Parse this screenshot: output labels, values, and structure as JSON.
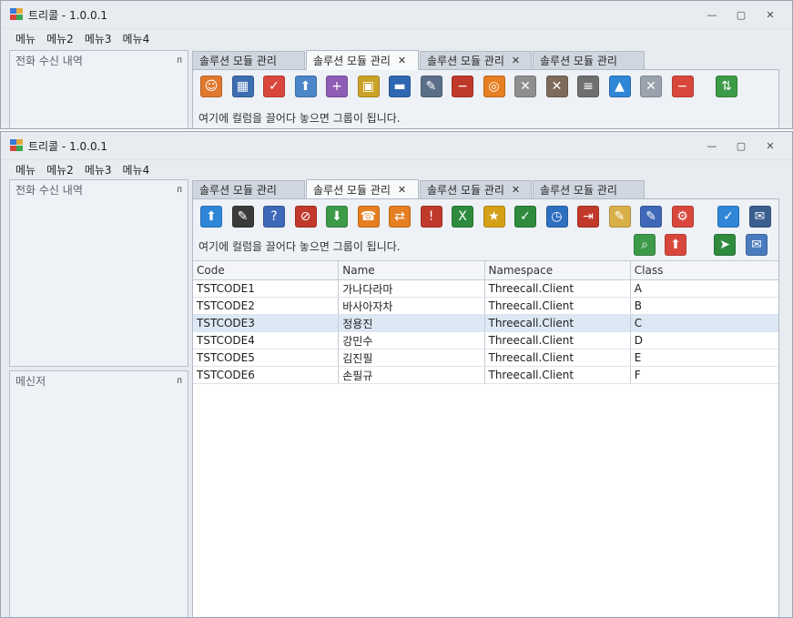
{
  "app": {
    "title": "트리콜 - 1.0.0.1"
  },
  "window_controls": {
    "minimize": "—",
    "maximize": "▢",
    "close": "✕"
  },
  "menu": [
    "메뉴",
    "메뉴2",
    "메뉴3",
    "메뉴4"
  ],
  "panels": {
    "call_log": "전화 수신 내역",
    "messenger": "메신저",
    "pin": "ᴨ"
  },
  "tabs": [
    {
      "label": "솔루션 모듈 관리",
      "closable": false,
      "active": false
    },
    {
      "label": "솔루션 모듈 관리",
      "closable": true,
      "active": true
    },
    {
      "label": "솔루션 모듈 관리",
      "closable": true,
      "active": false
    },
    {
      "label": "솔루션 모듈 관리",
      "closable": false,
      "active": false
    }
  ],
  "tab_close": "✕",
  "group_hint": "여기에 컬럼을 끌어다 놓으면 그룹이 됩니다.",
  "toolbar_back": [
    {
      "name": "user-card-icon",
      "glyph": "☺",
      "color": "#e0792e"
    },
    {
      "name": "window-grid-icon",
      "glyph": "▦",
      "color": "#3d6fb0"
    },
    {
      "name": "calendar-check-icon",
      "glyph": "✓",
      "color": "#d9473c"
    },
    {
      "name": "receipt-up-icon",
      "glyph": "⬆",
      "color": "#4a86c8"
    },
    {
      "name": "receipt-add-icon",
      "glyph": "+",
      "color": "#8e5bb5"
    },
    {
      "name": "document-lock-icon",
      "glyph": "▣",
      "color": "#c9a227"
    },
    {
      "name": "car-blue-icon",
      "glyph": "▬",
      "color": "#2e67b1"
    },
    {
      "name": "car-edit-icon",
      "glyph": "✎",
      "color": "#5b6f88"
    },
    {
      "name": "driver-remove-icon",
      "glyph": "−",
      "color": "#c0392b"
    },
    {
      "name": "wheel-icon",
      "glyph": "◎",
      "color": "#e67e22"
    },
    {
      "name": "user-delete-icon",
      "glyph": "✕",
      "color": "#8f8f8f"
    },
    {
      "name": "user-x-icon",
      "glyph": "✕",
      "color": "#7d6a5a"
    },
    {
      "name": "equalizer-delete-icon",
      "glyph": "≡",
      "color": "#6f6f6f"
    },
    {
      "name": "speaker-up-icon",
      "glyph": "▲",
      "color": "#2f86d6"
    },
    {
      "name": "speaker-mute-icon",
      "glyph": "✕",
      "color": "#9aa3ad"
    },
    {
      "name": "receipt-remove-icon",
      "glyph": "−",
      "color": "#d9473c"
    },
    {
      "name": "car-swap-icon",
      "glyph": "⇅",
      "color": "#3d9a48"
    }
  ],
  "toolbar_front_row1": [
    {
      "name": "export-save-icon",
      "glyph": "⬆",
      "color": "#2f86d6"
    },
    {
      "name": "save-edit-icon",
      "glyph": "✎",
      "color": "#3a3a3a"
    },
    {
      "name": "document-help-icon",
      "glyph": "?",
      "color": "#3f68b8"
    },
    {
      "name": "mail-block-icon",
      "glyph": "⊘",
      "color": "#c0392b"
    },
    {
      "name": "mail-down-icon",
      "glyph": "⬇",
      "color": "#3d9a48"
    },
    {
      "name": "phone-forward-icon",
      "glyph": "☎",
      "color": "#e67e22"
    },
    {
      "name": "phone-transfer-icon",
      "glyph": "⇄",
      "color": "#e67e22"
    },
    {
      "name": "user-warning-icon",
      "glyph": "!",
      "color": "#c0392b"
    },
    {
      "name": "excel-icon",
      "glyph": "X",
      "color": "#2e8b3e"
    },
    {
      "name": "user-star-icon",
      "glyph": "★",
      "color": "#d4a017"
    },
    {
      "name": "user-check-icon",
      "glyph": "✓",
      "color": "#2e8b3e"
    },
    {
      "name": "user-clock-icon",
      "glyph": "◷",
      "color": "#2f6fc0"
    },
    {
      "name": "user-logout-icon",
      "glyph": "⇥",
      "color": "#c0392b"
    },
    {
      "name": "tag-edit-icon",
      "glyph": "✎",
      "color": "#d8b04a"
    },
    {
      "name": "note-edit-icon",
      "glyph": "✎",
      "color": "#3f68b8"
    },
    {
      "name": "receipt-settings-icon",
      "glyph": "⚙",
      "color": "#d9473c"
    },
    {
      "name": "speaker-check-icon",
      "glyph": "✓",
      "color": "#2f86d6"
    },
    {
      "name": "mail-user-icon",
      "glyph": "✉",
      "color": "#3b5e8f"
    }
  ],
  "toolbar_front_row2": [
    {
      "name": "map-search-icon",
      "glyph": "⌕",
      "color": "#3d9a48"
    },
    {
      "name": "receipt-add-up-icon",
      "glyph": "⬆",
      "color": "#d9473c"
    },
    {
      "name": "runner-forward-icon",
      "glyph": "➤",
      "color": "#2e8b3e"
    },
    {
      "name": "user-mail-icon",
      "glyph": "✉",
      "color": "#4a7bbf"
    }
  ],
  "table": {
    "columns": [
      "Code",
      "Name",
      "Namespace",
      "Class"
    ],
    "rows": [
      [
        "TSTCODE1",
        "가나다라마",
        "Threecall.Client",
        "A"
      ],
      [
        "TSTCODE2",
        "바사아자차",
        "Threecall.Client",
        "B"
      ],
      [
        "TSTCODE3",
        "정용진",
        "Threecall.Client",
        "C"
      ],
      [
        "TSTCODE4",
        "강민수",
        "Threecall.Client",
        "D"
      ],
      [
        "TSTCODE5",
        "김진필",
        "Threecall.Client",
        "E"
      ],
      [
        "TSTCODE6",
        "손필규",
        "Threecall.Client",
        "F"
      ]
    ],
    "selected_row": 2
  }
}
